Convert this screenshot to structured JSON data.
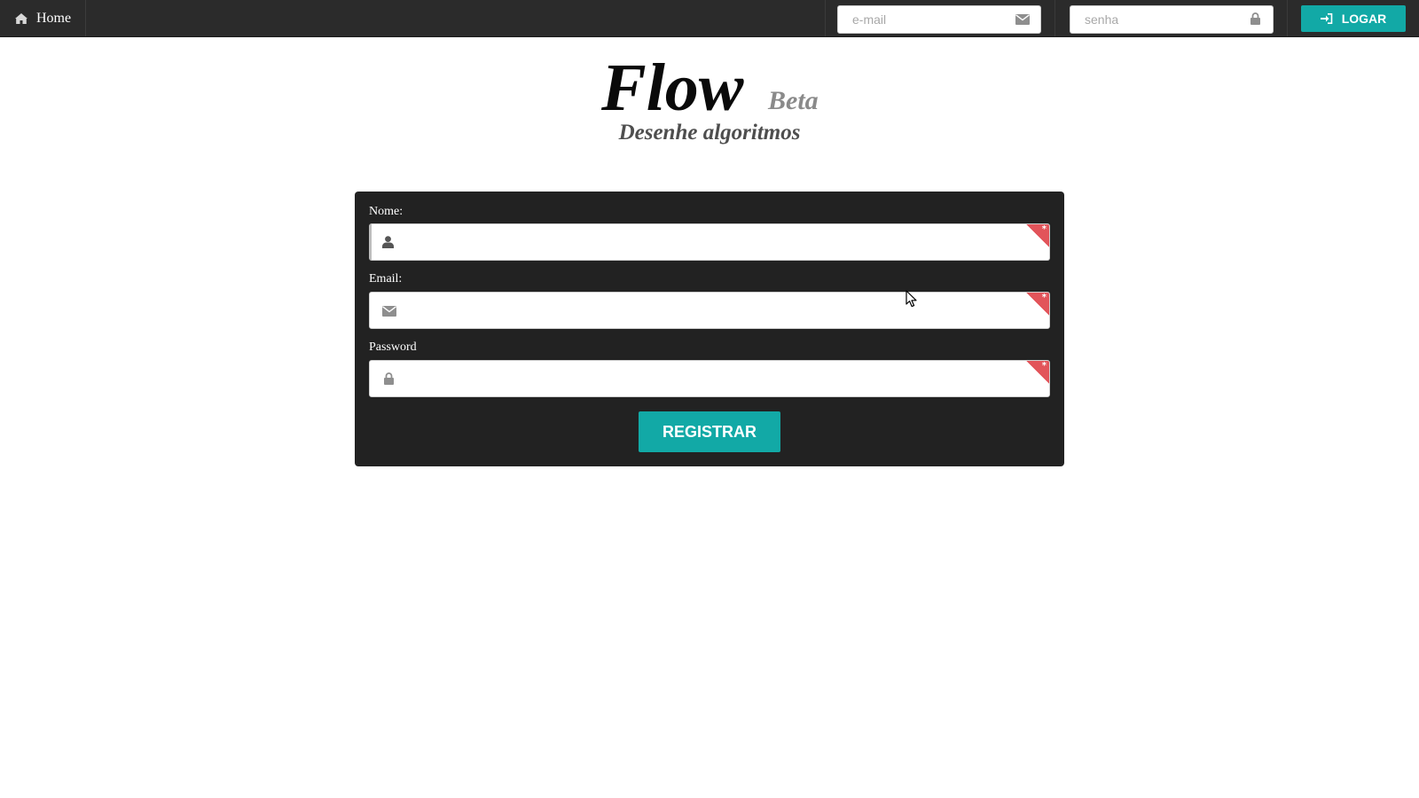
{
  "colors": {
    "topbar_bg": "#2b2b2b",
    "accent": "#12a9a6",
    "panel_bg": "#222222",
    "required_marker": "#e2545a"
  },
  "topbar": {
    "home": {
      "label": "Home",
      "icon": "home-icon"
    },
    "email_input": {
      "placeholder": "e-mail",
      "value": "",
      "icon": "envelope-icon"
    },
    "password_input": {
      "placeholder": "senha",
      "value": "",
      "icon": "lock-icon"
    },
    "login_button": {
      "label": "LOGAR",
      "icon": "sign-in-icon"
    }
  },
  "header": {
    "title": "Flow",
    "badge": "Beta",
    "subtitle": "Desenhe algoritmos"
  },
  "register_form": {
    "fields": [
      {
        "label": "Nome:",
        "value": "",
        "icon": "user-icon",
        "required": true
      },
      {
        "label": "Email:",
        "value": "",
        "icon": "envelope-icon",
        "required": true
      },
      {
        "label": "Password",
        "value": "",
        "icon": "lock-icon",
        "required": true
      }
    ],
    "required_marker": "*",
    "submit_label": "REGISTRAR"
  }
}
